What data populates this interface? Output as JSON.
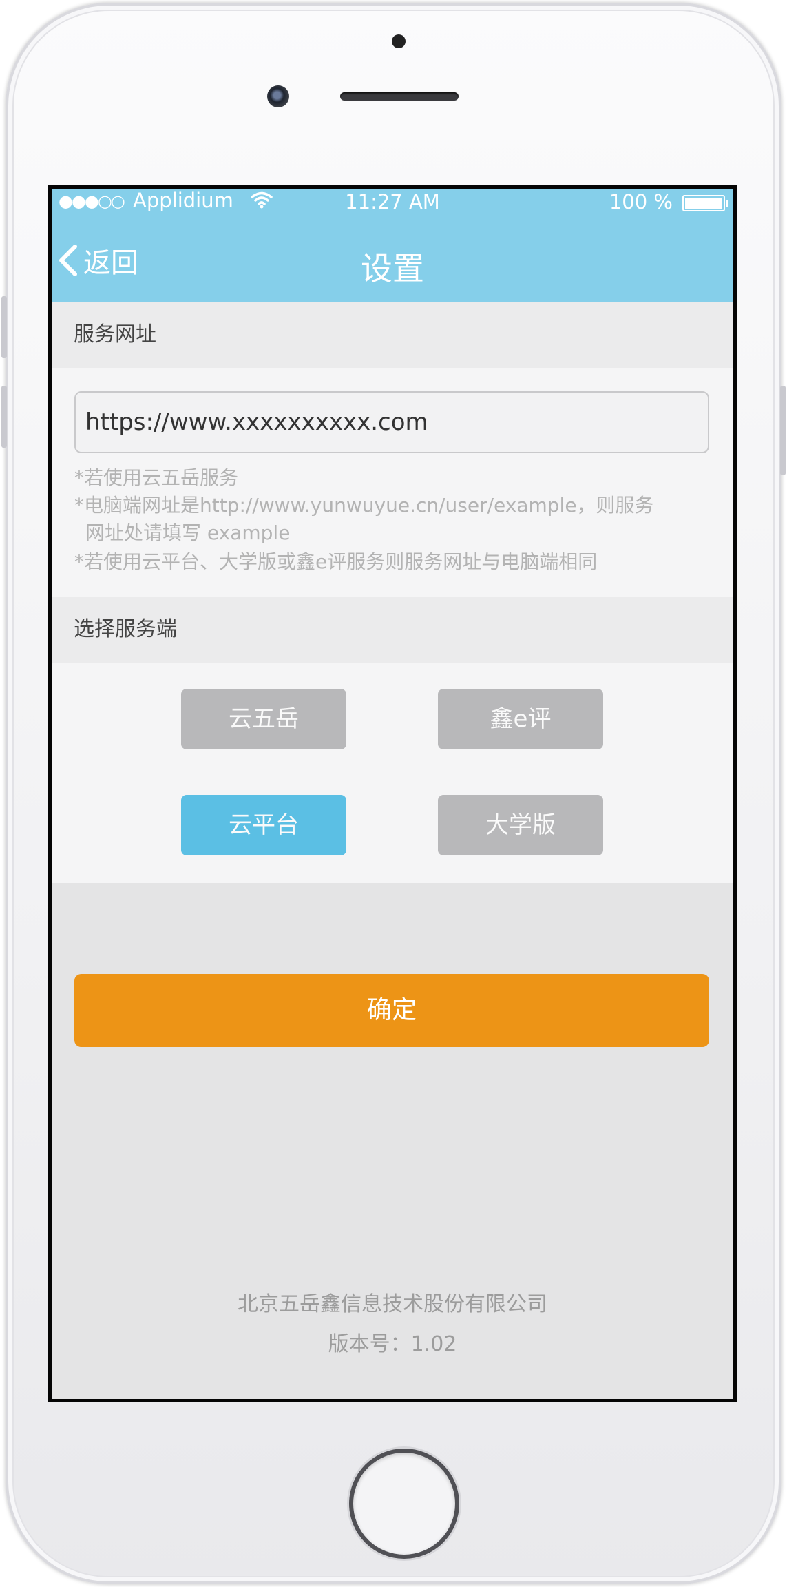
{
  "status_bar": {
    "signal_dots": "●●●○○",
    "carrier": "Applidium",
    "wifi_icon": "wifi-icon",
    "time": "11:27 AM",
    "battery_percent": "100 %",
    "battery_level": 1.0
  },
  "nav": {
    "back_label": "返回",
    "back_icon": "chevron-left-icon",
    "title": "设置"
  },
  "service_url": {
    "section_label": "服务网址",
    "value": "https://www.xxxxxxxxxx.com",
    "hints": [
      "*若使用云五岳服务",
      "*电脑端网址是http://www.yunwuyue.cn/user/example，则服务",
      "网址处请填写 example",
      "*若使用云平台、大学版或鑫e评服务则服务网址与电脑端相同"
    ]
  },
  "server_select": {
    "section_label": "选择服务端",
    "options": [
      {
        "label": "云五岳",
        "selected": false
      },
      {
        "label": "鑫e评",
        "selected": false
      },
      {
        "label": "云平台",
        "selected": true
      },
      {
        "label": "大学版",
        "selected": false
      }
    ]
  },
  "confirm_label": "确定",
  "footer": {
    "company": "北京五岳鑫信息技术股份有限公司",
    "version": "版本号：1.02"
  },
  "colors": {
    "header_blue": "#85cfea",
    "selected_blue": "#5bbfe4",
    "unselected_gray": "#b8b8ba",
    "confirm_orange": "#ed9416"
  }
}
